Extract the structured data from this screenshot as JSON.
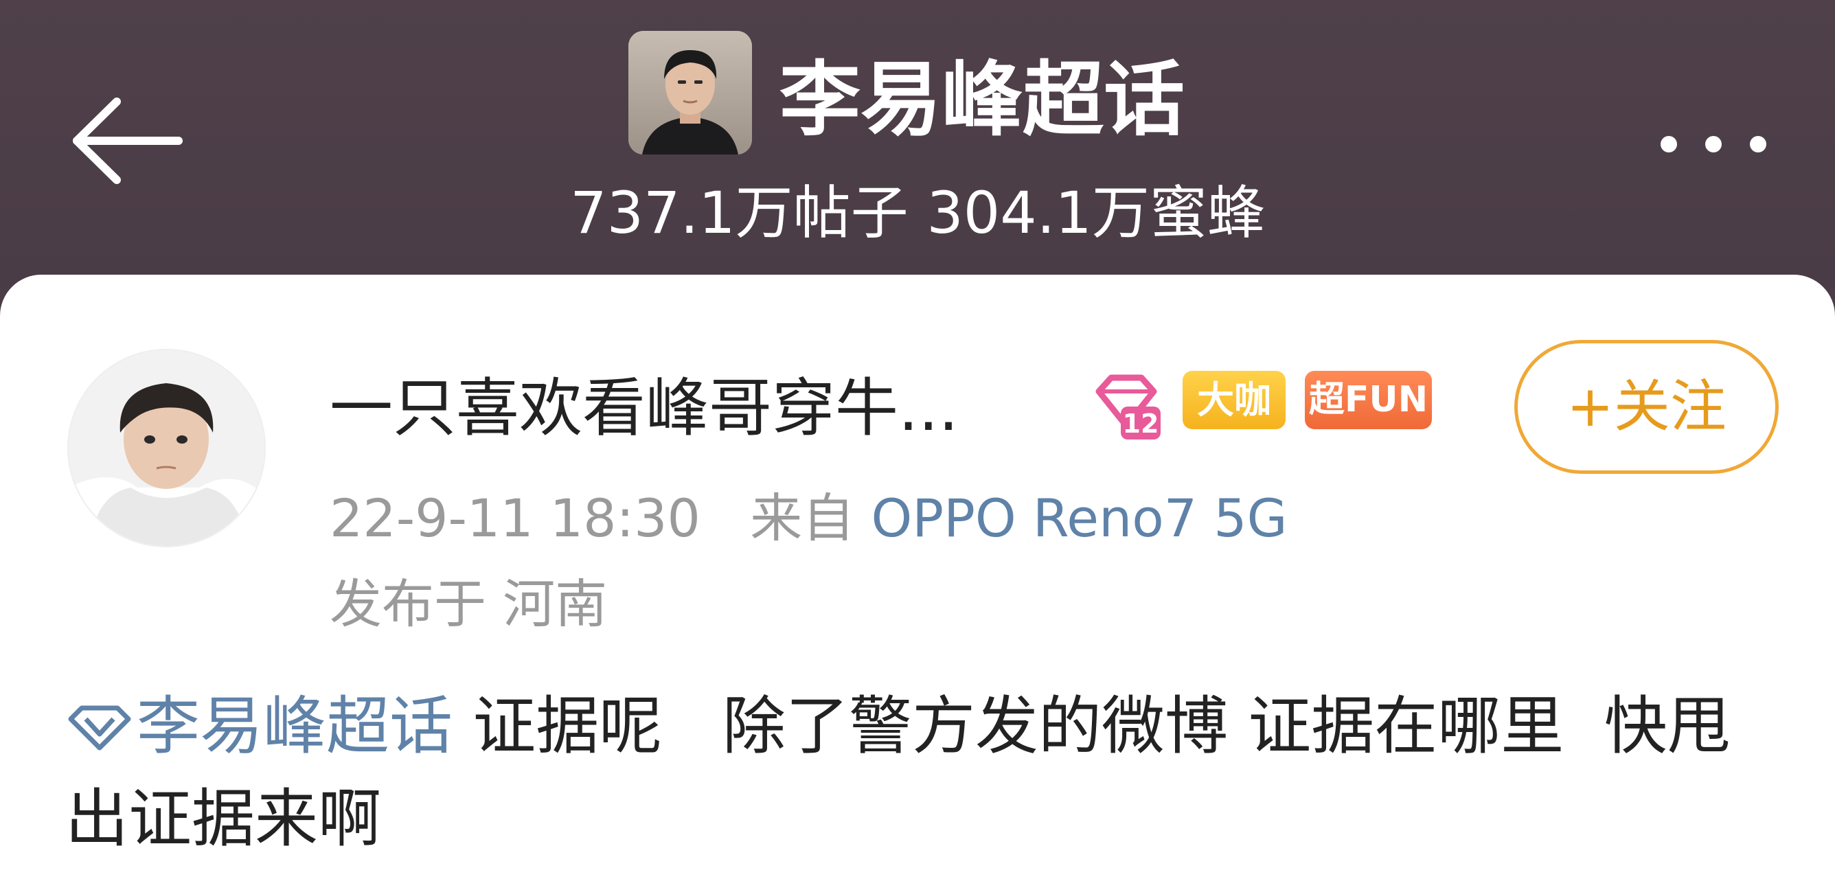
{
  "header": {
    "back_icon": "arrow-left-icon",
    "title": "李易峰超话",
    "stats": "737.1万帖子 304.1万蜜蜂",
    "more_icon": "more-dots-icon",
    "background_color": "#4a3d47"
  },
  "post": {
    "author": {
      "name": "一只喜欢看峰哥穿牛...",
      "level_badge": "12",
      "badges": [
        "大咖",
        "超FUN"
      ]
    },
    "follow_label": "+关注",
    "timestamp": "22-9-11 18:30",
    "source_prefix": "来自",
    "device": "OPPO Reno7 5G",
    "location": "发布于 河南",
    "topic": "李易峰超话",
    "text": " 证据呢   除了警方发的微博 证据在哪里  快甩出证据来啊"
  },
  "colors": {
    "link_blue": "#5f82a8",
    "follow_orange": "#e69b1c",
    "badge_gold": "#f6b21e",
    "badge_orange": "#ef6a38",
    "level_pink": "#e85a9a"
  }
}
